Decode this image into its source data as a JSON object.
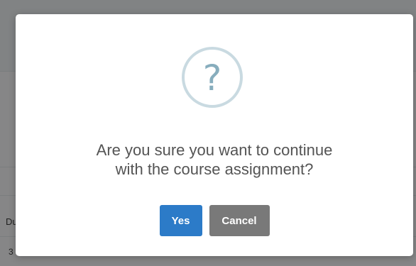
{
  "underlay": {
    "column_header_fragment": "Du",
    "cell_fragment": "3"
  },
  "dialog": {
    "icon": "question-icon",
    "icon_glyph": "?",
    "message_line1": "Are you sure you want to continue",
    "message_line2": "with the course assignment?",
    "confirm_label": "Yes",
    "cancel_label": "Cancel",
    "colors": {
      "confirm": "#2c7bc8",
      "cancel": "#797979",
      "icon_ring": "#c9dae1",
      "icon_glyph": "#87adbd"
    }
  }
}
